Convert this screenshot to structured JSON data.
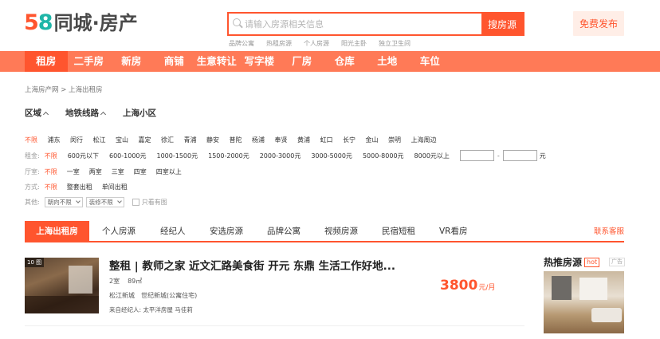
{
  "header": {
    "logo_number": "58",
    "logo_text": "同城·房产",
    "search_placeholder": "请输入房源相关信息",
    "search_button": "搜房源",
    "hotwords": [
      "品牌公寓",
      "热租房源",
      "个人房源",
      "阳光主卧",
      "独立卫生间"
    ],
    "publish_button": "免费发布"
  },
  "nav": {
    "items": [
      "租房",
      "二手房",
      "新房",
      "商铺",
      "生意转让",
      "写字楼",
      "厂房",
      "仓库",
      "土地",
      "车位"
    ],
    "active": "租房"
  },
  "breadcrumb": "上海房产网 > 上海出租房",
  "filter_tabs": {
    "region": "区域",
    "subway": "地铁线路",
    "community": "上海小区"
  },
  "districts": [
    "不限",
    "浦东",
    "闵行",
    "松江",
    "宝山",
    "嘉定",
    "徐汇",
    "青浦",
    "静安",
    "普陀",
    "杨浦",
    "奉贤",
    "黄浦",
    "虹口",
    "长宁",
    "金山",
    "崇明",
    "上海周边"
  ],
  "rent": {
    "label": "租金:",
    "options": [
      "不限",
      "600元以下",
      "600-1000元",
      "1000-1500元",
      "1500-2000元",
      "2000-3000元",
      "3000-5000元",
      "5000-8000元",
      "8000元以上"
    ],
    "dash": "-",
    "unit": "元"
  },
  "rooms": {
    "label": "厅室:",
    "options": [
      "不限",
      "一室",
      "两室",
      "三室",
      "四室",
      "四室以上"
    ]
  },
  "way": {
    "label": "方式:",
    "options": [
      "不限",
      "整套出租",
      "单间出租"
    ]
  },
  "other": {
    "label": "其他:",
    "orientation": "朝向不限",
    "decoration": "装修不限",
    "only_images": "只看有图"
  },
  "listing_tabs": [
    "上海出租房",
    "个人房源",
    "经纪人",
    "安选房源",
    "品牌公寓",
    "视频房源",
    "民宿短租",
    "VR看房"
  ],
  "contact_customer_service": "联系客服",
  "listing": {
    "image_count": "10 图",
    "title": "整租 | 教师之家 近文汇路美食街 开元 东鼎 生活工作好地...",
    "layout": "2室",
    "area": "89㎡",
    "district": "松江新城",
    "community": "世纪新城(公寓住宅)",
    "agent": "来自经纪人: 太平洋房屋 马佳莉",
    "price": "3800",
    "price_unit": "元/月"
  },
  "sidebar": {
    "title": "热推房源",
    "hot_badge": "hot",
    "ad_badge": "广告"
  },
  "colors": {
    "accent": "#ff552e",
    "nav_bg": "#ff7a57",
    "logo_teal": "#1fb6a8"
  }
}
